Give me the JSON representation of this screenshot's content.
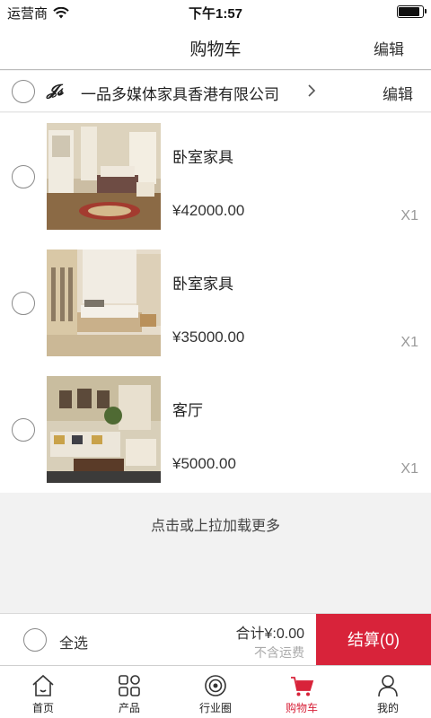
{
  "status_bar": {
    "carrier": "运营商",
    "time": "下午1:57",
    "battery_level": 0.9
  },
  "nav": {
    "title": "购物车",
    "edit_label": "编辑"
  },
  "shop": {
    "logo_text": "𝓙𝓼",
    "name": "一品多媒体家具香港有限公司",
    "edit_label": "编辑",
    "chevron_icon": "chevron-right-icon"
  },
  "items": [
    {
      "name": "卧室家具",
      "price": "¥42000.00",
      "qty": "X1",
      "image": "bedroom-furniture-classic"
    },
    {
      "name": "卧室家具",
      "price": "¥35000.00",
      "qty": "X1",
      "image": "bedroom-furniture-modern"
    },
    {
      "name": "客厅",
      "price": "¥5000.00",
      "qty": "X1",
      "image": "living-room"
    }
  ],
  "load_more": "点击或上拉加载更多",
  "checkout": {
    "select_all": "全选",
    "total": "合计¥:0.00",
    "shipping_note": "不含运费",
    "button_label": "结算(0)"
  },
  "tabs": [
    {
      "label": "首页",
      "icon": "home-icon"
    },
    {
      "label": "产品",
      "icon": "grid-icon"
    },
    {
      "label": "行业圈",
      "icon": "circle-icon"
    },
    {
      "label": "购物车",
      "icon": "cart-icon",
      "active": true
    },
    {
      "label": "我的",
      "icon": "user-icon"
    }
  ],
  "colors": {
    "accent": "#d8233a",
    "background": "#f2f2f2"
  }
}
